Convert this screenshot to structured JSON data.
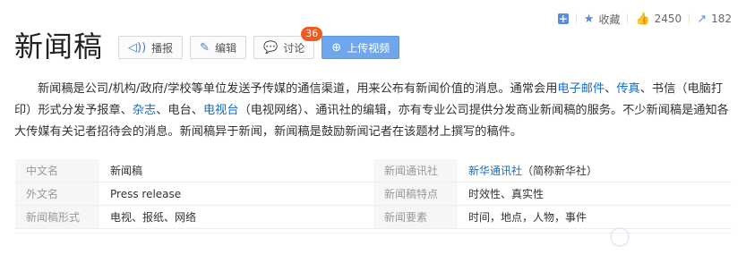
{
  "actions": {
    "favorite_label": "收藏",
    "like_count": "2450",
    "share_count": "182"
  },
  "title": "新闻稿",
  "buttons": {
    "report": "播报",
    "edit": "编辑",
    "discuss": "讨论",
    "discuss_badge": "36",
    "upload_video": "上传视频"
  },
  "description": {
    "p1": "新闻稿是公司/机构/政府/学校等单位发送予传媒的通信渠道，用来公布有新闻价值的消息。通常会用",
    "link_email": "电子邮件",
    "sep1": "、",
    "link_fax": "传真",
    "p2": "、书信（电脑打印）形式分发予报章、",
    "link_magazine": "杂志",
    "p3": "、电台、",
    "link_tv": "电视台",
    "p4": "（电视网络）、通讯社的编辑，亦有专业公司提供分发商业新闻稿的服务。不少新闻稿是通知各大传媒有关记者招待会的消息。新闻稿异于新闻，新闻稿是鼓励新闻记者在该题材上撰写的稿件。"
  },
  "info": {
    "rows": [
      {
        "k1": "中文名",
        "v1": "新闻稿",
        "k2": "新闻通讯社",
        "v2_link": "新华通讯社",
        "v2_rest": "（简称新华社）"
      },
      {
        "k1": "外文名",
        "v1": "Press release",
        "k2": "新闻稿特点",
        "v2_link": "",
        "v2_rest": "时效性、真实性"
      },
      {
        "k1": "新闻稿形式",
        "v1": "电视、报纸、网络",
        "k2": "新闻要素",
        "v2_link": "",
        "v2_rest": "时间，地点，人物，事件"
      }
    ]
  },
  "colors": {
    "link": "#136ec2",
    "primary_button": "#6fa7ee",
    "badge": "#f05a22",
    "icon": "#5b8bdf"
  }
}
